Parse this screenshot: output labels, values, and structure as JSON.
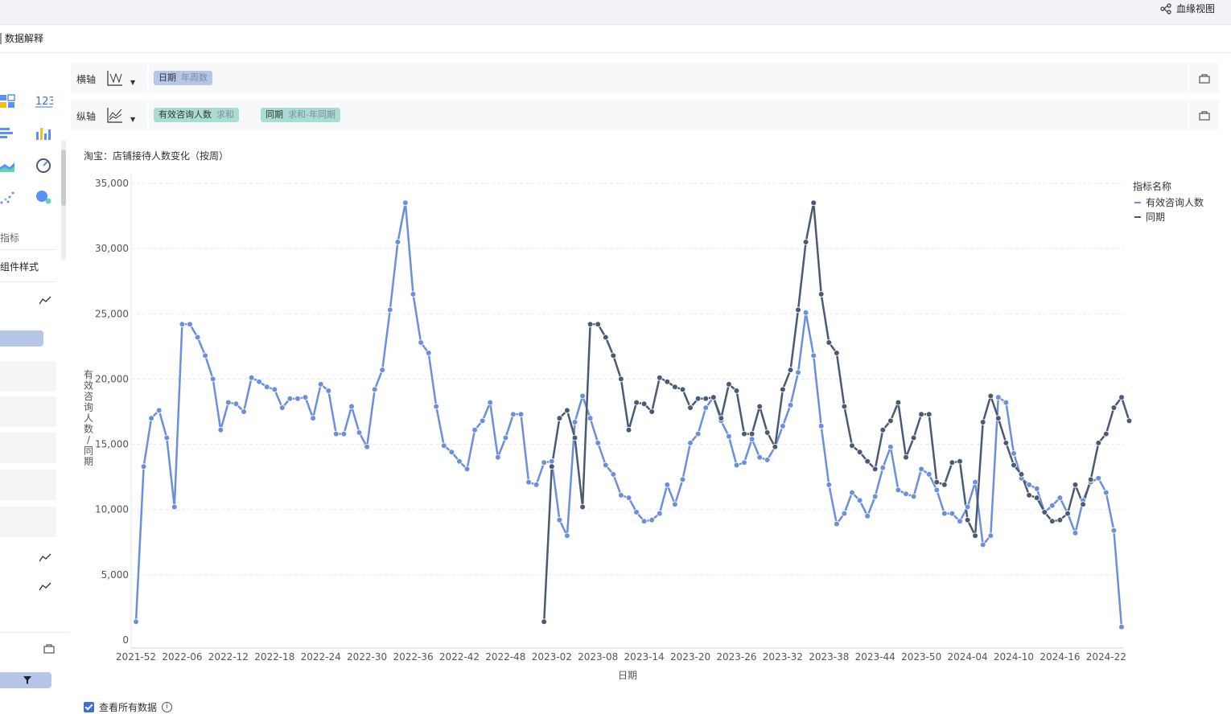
{
  "topbar": {
    "lineage_label": "血缘视图"
  },
  "subbar": {
    "title": "数据解释"
  },
  "left_panel": {
    "metric_label": "指标",
    "style_label": "组件样式"
  },
  "x_shelf": {
    "label": "横轴",
    "pill": {
      "main": "日期",
      "sub": "年周数"
    }
  },
  "y_shelf": {
    "label": "纵轴",
    "pills": [
      {
        "main": "有效咨询人数",
        "sub": "求和"
      },
      {
        "main": "同期",
        "sub": "求和-年同期"
      }
    ]
  },
  "footer": {
    "checkbox_label": "查看所有数据",
    "info_icon": "i"
  },
  "colors": {
    "current": "#6b8fdc",
    "previous": "#4b5a73",
    "accent": "#b6c6e8",
    "teal": "#a9ddd3"
  },
  "chart_data": {
    "type": "line",
    "title": "淘宝：店铺接待人数变化（按周）",
    "xlabel": "日期",
    "ylabel": "有效咨询人数/同期",
    "ylim": [
      0,
      35000
    ],
    "yticks": [
      "35,000",
      "30,000",
      "25,000",
      "20,000",
      "15,000",
      "10,000",
      "5,000",
      "0"
    ],
    "ytick_values": [
      35000,
      30000,
      25000,
      20000,
      15000,
      10000,
      5000,
      0
    ],
    "xticks": [
      "2021-52",
      "2022-06",
      "2022-12",
      "2022-18",
      "2022-24",
      "2022-30",
      "2022-36",
      "2022-42",
      "2022-48",
      "2023-02",
      "2023-08",
      "2023-14",
      "2023-20",
      "2023-26",
      "2023-32",
      "2023-38",
      "2023-44",
      "2023-50",
      "2024-04",
      "2024-10",
      "2024-16",
      "2024-22"
    ],
    "grid": true,
    "legend": {
      "title": "指标名称",
      "position": "top-right"
    },
    "series": [
      {
        "name": "有效咨询人数",
        "values": [
          1400,
          13300,
          17000,
          17600,
          15500,
          10200,
          24200,
          24200,
          23200,
          21800,
          20000,
          16100,
          18200,
          18100,
          17500,
          20100,
          19800,
          19400,
          19200,
          17800,
          18500,
          18500,
          18600,
          17000,
          19600,
          19100,
          15800,
          15800,
          17900,
          15900,
          14800,
          19200,
          20700,
          25300,
          30500,
          33500,
          26500,
          22800,
          22000,
          17900,
          14900,
          14400,
          13700,
          13100,
          16100,
          16800,
          18200,
          14000,
          15500,
          17300,
          17300,
          12100,
          11900,
          13600,
          13700,
          9200,
          8000,
          16700,
          18700,
          17000,
          15100,
          13400,
          12700,
          11100,
          10900,
          9800,
          9100,
          9200,
          9700,
          11900,
          10400,
          12300,
          15100,
          15800,
          17800,
          18600,
          16800,
          15600,
          13400,
          13600,
          15400,
          14000,
          13800,
          14800,
          16400,
          18000,
          20500,
          25100,
          21800,
          16400,
          11900,
          8900,
          9700,
          11300,
          10700,
          9500,
          11000,
          13200,
          14800,
          11500,
          11200,
          11000,
          13100,
          12700,
          11500,
          9700,
          9700,
          9100,
          10200,
          12100,
          7300,
          8000,
          18600,
          18200,
          14300,
          12400,
          11900,
          11600,
          9800,
          10300,
          10900,
          9700,
          8200,
          10700,
          12100,
          12400,
          11300,
          8400,
          1000
        ]
      },
      {
        "name": "同期",
        "values": [
          null,
          null,
          null,
          null,
          null,
          null,
          null,
          null,
          null,
          null,
          null,
          null,
          null,
          null,
          null,
          null,
          null,
          null,
          null,
          null,
          null,
          null,
          null,
          null,
          null,
          null,
          null,
          null,
          null,
          null,
          null,
          null,
          null,
          null,
          null,
          null,
          null,
          null,
          null,
          null,
          null,
          null,
          null,
          null,
          null,
          null,
          null,
          null,
          null,
          null,
          null,
          null,
          null,
          1400,
          13300,
          17000,
          17600,
          15500,
          10200,
          24200,
          24200,
          23200,
          21800,
          20000,
          16100,
          18200,
          18100,
          17500,
          20100,
          19800,
          19400,
          19200,
          17800,
          18500,
          18500,
          18600,
          17000,
          19600,
          19100,
          15800,
          15800,
          17900,
          15900,
          14800,
          19200,
          20700,
          25300,
          30500,
          33500,
          26500,
          22800,
          22000,
          17900,
          14900,
          14400,
          13700,
          13100,
          16100,
          16800,
          18200,
          14000,
          15500,
          17300,
          17300,
          12100,
          11900,
          13600,
          13700,
          9200,
          8000,
          16700,
          18700,
          17000,
          15100,
          13400,
          12700,
          11100,
          10900,
          9800,
          9100,
          9200,
          9700,
          11900,
          10400,
          12300,
          15100,
          15800,
          17800,
          18600,
          16800
        ]
      }
    ]
  }
}
